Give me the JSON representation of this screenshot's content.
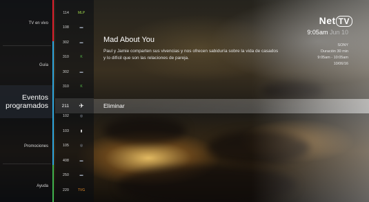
{
  "colors": {
    "stripe_top": "#e0202c",
    "stripe_mid": "#2fa8e0",
    "stripe_bottom": "#3fb34f"
  },
  "menu": {
    "items": [
      {
        "label": "TV en vivo"
      },
      {
        "label": "Guía"
      },
      {
        "label": "Eventos programados",
        "active": true
      },
      {
        "label": "Promociones"
      },
      {
        "label": "Ayuda"
      }
    ]
  },
  "channels": [
    {
      "number": "114",
      "logo_icon": "mlp-logo-icon"
    },
    {
      "number": "108",
      "logo_icon": "channel-logo-icon"
    },
    {
      "number": "302",
      "logo_icon": "channel-logo-icon"
    },
    {
      "number": "310",
      "logo_icon": "k-logo-icon"
    },
    {
      "number": "302",
      "logo_icon": "channel-logo-icon"
    },
    {
      "number": "310",
      "logo_icon": "k-logo-icon"
    },
    {
      "number": "211",
      "logo_icon": "plane-logo-icon",
      "selected": true
    },
    {
      "number": "102",
      "logo_icon": "circle-logo-icon"
    },
    {
      "number": "103",
      "logo_icon": "bars-logo-icon"
    },
    {
      "number": "105",
      "logo_icon": "circle-logo-icon"
    },
    {
      "number": "408",
      "logo_icon": "channel-logo-icon"
    },
    {
      "number": "250",
      "logo_icon": "channel-logo-icon"
    },
    {
      "number": "220",
      "logo_icon": "tvg-logo-icon"
    }
  ],
  "brand": {
    "name": "Net",
    "suffix": "TV"
  },
  "clock": {
    "time": "9:05am",
    "date": "Jun 10"
  },
  "program": {
    "title": "Mad About You",
    "description": "Paul y Jamie comparten sus vivencias y nos ofrecen sabiduría sobre la vida de casados y lo difícil que son las relaciones de pareja.",
    "network": "SONY",
    "duration": "Duración 30 min",
    "time_range": "9:05am - 10:05am",
    "date": "10/06/16"
  },
  "action": {
    "label": "Eliminar"
  }
}
